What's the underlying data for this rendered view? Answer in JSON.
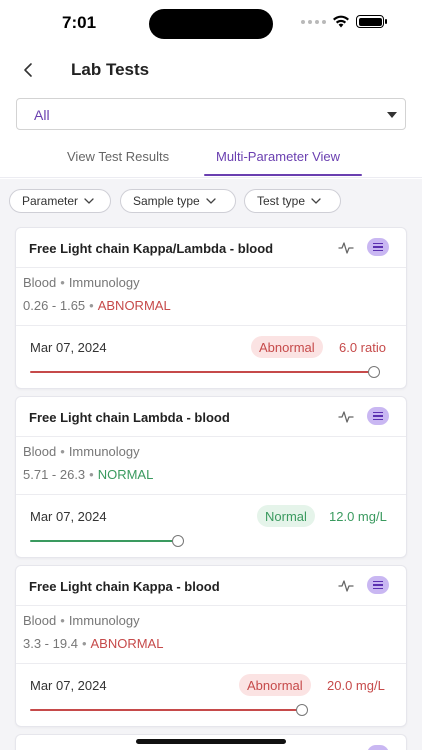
{
  "status_bar": {
    "time": "7:01"
  },
  "nav": {
    "title": "Lab Tests"
  },
  "filter_select": {
    "value": "All"
  },
  "tabs": [
    {
      "label": "View Test Results"
    },
    {
      "label": "Multi-Parameter View"
    }
  ],
  "chips": [
    {
      "label": "Parameter"
    },
    {
      "label": "Sample type"
    },
    {
      "label": "Test type"
    }
  ],
  "colors": {
    "accent": "#6a3fb0",
    "abnormal": "#c64a4a",
    "normal": "#3a9a5f"
  },
  "cards": [
    {
      "title": "Free Light chain Kappa/Lambda - blood",
      "sample": "Blood",
      "category": "Immunology",
      "range": "0.26 - 1.65",
      "flag": "ABNORMAL",
      "date": "Mar 07, 2024",
      "status": "Abnormal",
      "value": "6.0 ratio",
      "slider_level": 0.95
    },
    {
      "title": "Free Light chain Lambda - blood",
      "sample": "Blood",
      "category": "Immunology",
      "range": "5.71 - 26.3",
      "flag": "NORMAL",
      "date": "Mar 07, 2024",
      "status": "Normal",
      "value": "12.0 mg/L",
      "slider_level": 0.41
    },
    {
      "title": "Free Light chain Kappa - blood",
      "sample": "Blood",
      "category": "Immunology",
      "range": "3.3 - 19.4",
      "flag": "ABNORMAL",
      "date": "Mar 07, 2024",
      "status": "Abnormal",
      "value": "20.0 mg/L",
      "slider_level": 0.75
    }
  ]
}
